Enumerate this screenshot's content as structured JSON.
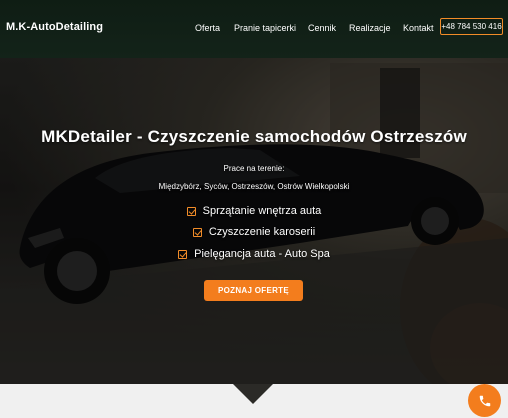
{
  "header": {
    "brand": "M.K-AutoDetailing",
    "nav": [
      {
        "label": "Oferta"
      },
      {
        "label": "Pranie tapicerki"
      },
      {
        "label": "Cennik"
      },
      {
        "label": "Realizacje"
      },
      {
        "label": "Kontakt"
      }
    ],
    "phone": "+48 784 530 416"
  },
  "hero": {
    "title": "MKDetailer - Czyszczenie samochodów Ostrzeszów",
    "area_label": "Prace na terenie:",
    "area_list": "Międzybórz, Syców, Ostrzeszów, Ostrów Wielkopolski",
    "features": [
      {
        "label": "Sprzątanie wnętrza auta"
      },
      {
        "label": "Czyszczenie karoserii"
      },
      {
        "label": "Pielęgancja auta - Auto Spa"
      }
    ],
    "cta_label": "POZNAJ OFERTĘ"
  },
  "colors": {
    "accent": "#f37d1d",
    "navbar": "#132319",
    "bottom": "#f0f0f0"
  },
  "icons": {
    "feature": "checkbox-check-icon",
    "fab": "phone-icon",
    "scroll": "down-arrow-icon"
  }
}
